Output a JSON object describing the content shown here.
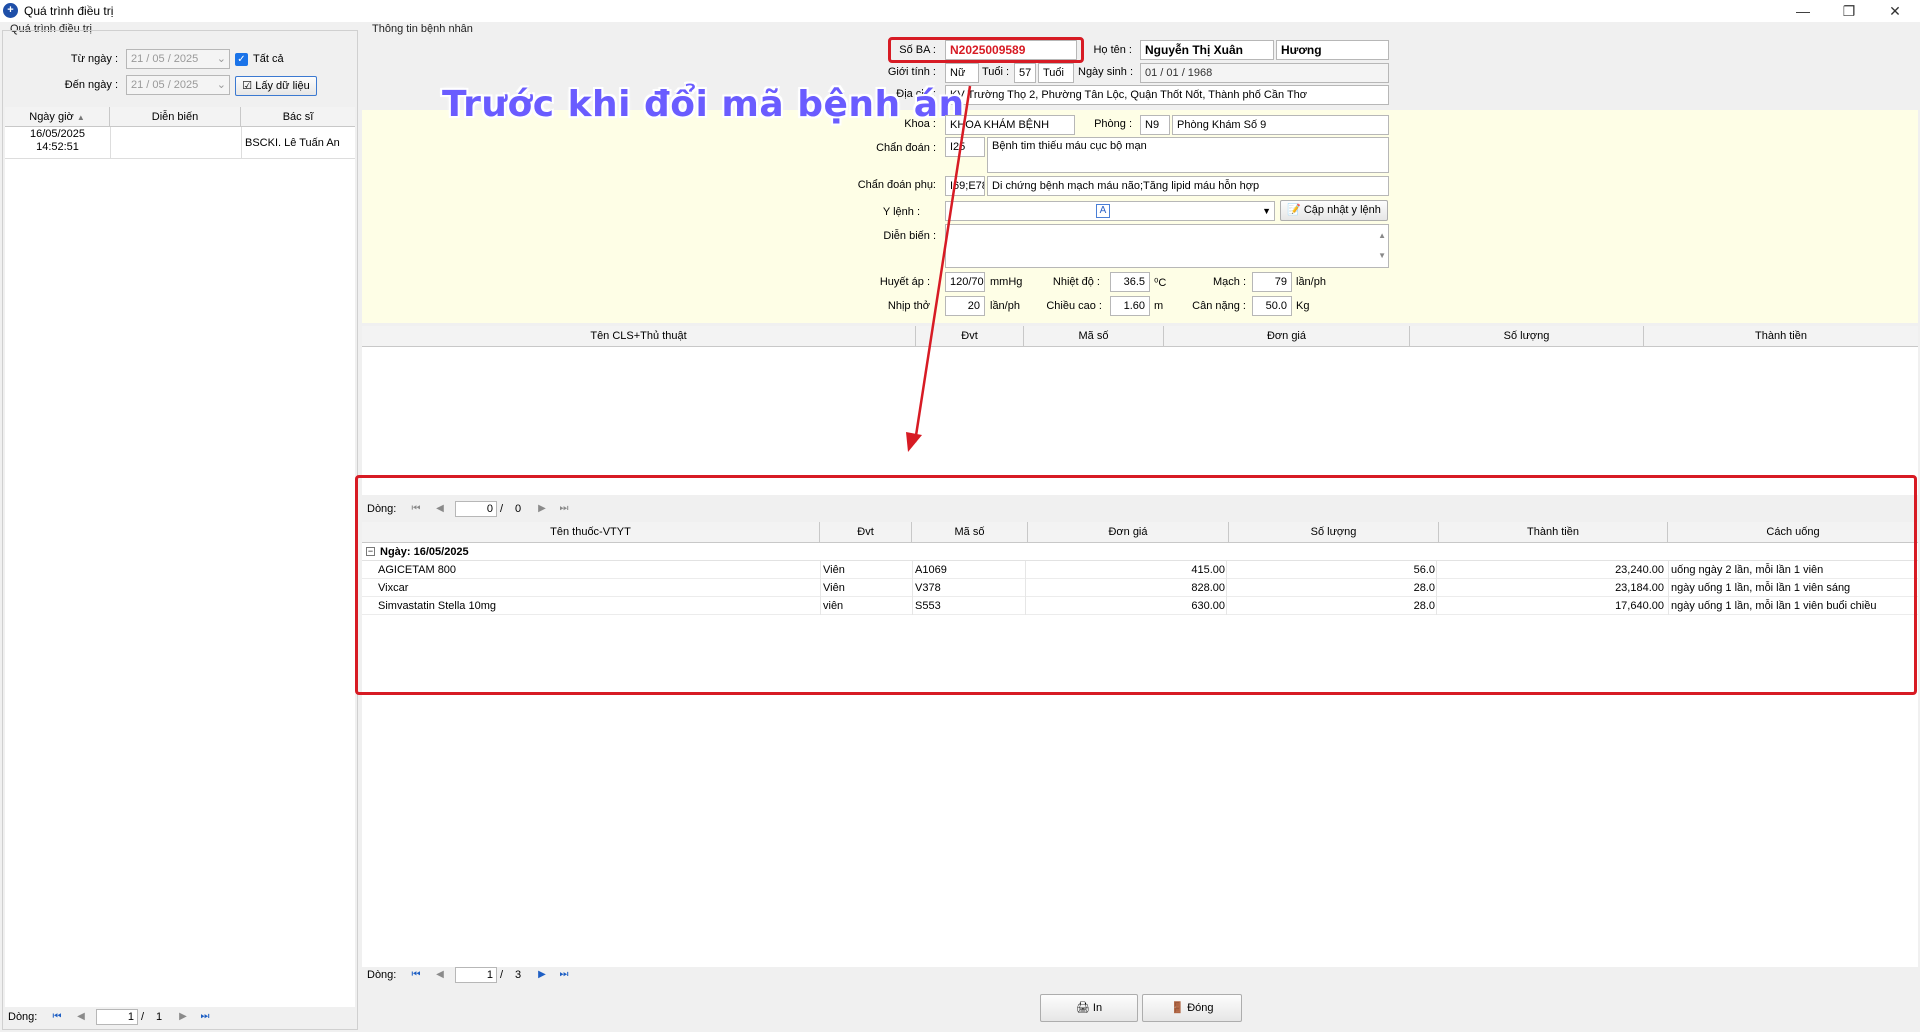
{
  "window": {
    "title": "Quá trình điều trị",
    "min": "—",
    "max": "❐",
    "close": "✕"
  },
  "left": {
    "group_label": "Quá trình điều trị",
    "from_label": "Từ ngày :",
    "from_value": "21 / 05 / 2025",
    "to_label": "Đến ngày :",
    "to_value": "21 / 05 / 2025",
    "all_label": "Tất cả",
    "fetch_label": "Lấy dữ liệu",
    "columns": [
      "Ngày giờ",
      "Diễn biến",
      "Bác sĩ"
    ],
    "rows": [
      {
        "date": "16/05/2025",
        "time": "14:52:51",
        "progress": "",
        "doctor": "BSCKI. Lê Tuấn An"
      }
    ],
    "pager": {
      "label": "Dòng:",
      "current": "1",
      "sep": "/",
      "total": "1"
    }
  },
  "patient": {
    "group_label": "Thông tin bệnh nhân",
    "so_ba_label": "Số BA :",
    "so_ba": "N2025009589",
    "ho_ten_label": "Họ tên :",
    "ho_ten_1": "Nguyễn Thị Xuân",
    "ho_ten_2": "Hương",
    "gioi_tinh_label": "Giới tính :",
    "gioi_tinh": "Nữ",
    "tuoi_label": "Tuổi :",
    "tuoi": "57",
    "tuoi_unit": "Tuổi",
    "ngay_sinh_label": "Ngày sinh :",
    "ngay_sinh": "01 / 01 / 1968",
    "dia_chi_label": "Địa chỉ :",
    "dia_chi": "KV Trường Thọ 2, Phường Tân Lộc, Quận Thốt Nốt, Thành phố Cần Thơ",
    "khoa_label": "Khoa :",
    "khoa": "KHOA KHÁM BỆNH",
    "phong_label": "Phòng :",
    "phong_code": "N9",
    "phong": "Phòng Khám Số 9",
    "chan_doan_label": "Chẩn đoán :",
    "chan_doan_code": "I25",
    "chan_doan": "Bệnh tim thiếu máu cục bộ mạn",
    "chan_doan_phu_label": "Chẩn đoán phụ:",
    "chan_doan_phu_code": "I69;E78",
    "chan_doan_phu": "Di chứng bệnh mạch máu não;Tăng lipid máu hỗn hợp",
    "y_lenh_label": "Y lệnh :",
    "cap_nhat_label": "Cập nhật y lệnh",
    "dien_bien_label": "Diễn biến :",
    "huyet_ap_label": "Huyết áp :",
    "huyet_ap": "120/70",
    "huyet_ap_unit": "mmHg",
    "nhiet_do_label": "Nhiệt độ :",
    "nhiet_do": "36.5",
    "nhiet_do_unit": "⁰C",
    "mach_label": "Mạch :",
    "mach": "79",
    "mach_unit": "lần/ph",
    "nhip_tho_label": "Nhịp thở",
    "nhip_tho": "20",
    "nhip_tho_unit": "lần/ph",
    "chieu_cao_label": "Chiều cao :",
    "chieu_cao": "1.60",
    "chieu_cao_unit": "m",
    "can_nang_label": "Cân nặng :",
    "can_nang": "50.0",
    "can_nang_unit": "Kg"
  },
  "cls_grid": {
    "columns": [
      "Tên CLS+Thủ thuật",
      "Đvt",
      "Mã số",
      "Đơn giá",
      "Số lượng",
      "Thành tiền"
    ],
    "pager": {
      "label": "Dòng:",
      "current": "0",
      "sep": "/",
      "total": "0"
    }
  },
  "drug_grid": {
    "columns": [
      "Tên thuốc-VTYT",
      "Đvt",
      "Mã số",
      "Đơn giá",
      "Số lượng",
      "Thành tiền",
      "Cách uống"
    ],
    "group_label": "Ngày:  16/05/2025",
    "rows": [
      {
        "name": "AGICETAM 800",
        "unit": "Viên",
        "code": "A1069",
        "price": "415.00",
        "qty": "56.0",
        "total": "23,240.00",
        "usage": "uống ngày 2 lần, mỗi lần 1 viên"
      },
      {
        "name": "Vixcar",
        "unit": "Viên",
        "code": "V378",
        "price": "828.00",
        "qty": "28.0",
        "total": "23,184.00",
        "usage": "ngày uống 1 lần, mỗi lần 1 viên sáng"
      },
      {
        "name": "Simvastatin Stella 10mg",
        "unit": "viên",
        "code": "S553",
        "price": "630.00",
        "qty": "28.0",
        "total": "17,640.00",
        "usage": "ngày uống 1 lần, mỗi lần 1 viên buổi chiều"
      }
    ],
    "pager": {
      "label": "Dòng:",
      "current": "1",
      "sep": "/",
      "total": "3"
    }
  },
  "footer": {
    "print_label": "In",
    "close_label": "Đóng"
  },
  "annotation": {
    "text": "Trước khi đổi mã bệnh án",
    "color": "#d71b24"
  }
}
